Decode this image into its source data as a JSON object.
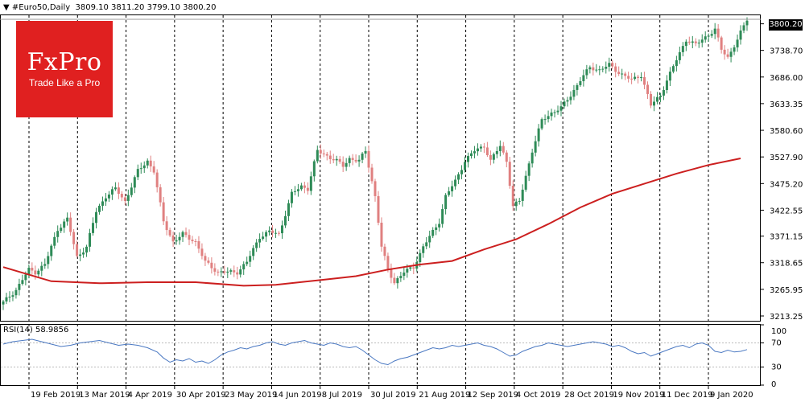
{
  "header": {
    "symbol": "#Euro50,Daily",
    "ohlc": "3809.10 3811.20 3799.10 3800.20",
    "current_price": "3800.20"
  },
  "logo": {
    "brand": "FxPro",
    "tagline": "Trade Like a Pro",
    "color": "#e02020"
  },
  "rsi_header": {
    "label": "RSI(14) 58.9856"
  },
  "colors": {
    "bull": "#2e8b57",
    "bear": "#e08080",
    "ma": "#cc1f1f",
    "rsi": "#4a78c2",
    "grid": "#000000"
  },
  "chart_data": [
    {
      "type": "candlestick",
      "title": "#Euro50,Daily",
      "ylim": [
        3213.25,
        3800.2
      ],
      "yticks": [
        3791.25,
        3738.7,
        3686.0,
        3633.35,
        3580.6,
        3527.9,
        3475.2,
        3422.55,
        3371.15,
        3318.65,
        3265.95,
        3213.25
      ],
      "ytick_labels": [
        "3791.25",
        "3738.70",
        "3686.00",
        "3633.35",
        "3580.60",
        "3527.90",
        "3475.20",
        "3422.55",
        "3371.15",
        "3318.65",
        "3265.95",
        "3213.25"
      ],
      "x_labels": [
        "19 Feb 2019",
        "13 Mar 2019",
        "4 Apr 2019",
        "30 Apr 2019",
        "23 May 2019",
        "14 Jun 2019",
        "8 Jul 2019",
        "30 Jul 2019",
        "21 Aug 2019",
        "12 Sep 2019",
        "4 Oct 2019",
        "28 Oct 2019",
        "19 Nov 2019",
        "11 Dec 2019",
        "9 Jan 2020"
      ],
      "close_path": [
        [
          0,
          3240
        ],
        [
          4,
          3265
        ],
        [
          8,
          3305
        ],
        [
          10,
          3300
        ],
        [
          13,
          3315
        ],
        [
          17,
          3385
        ],
        [
          20,
          3405
        ],
        [
          23,
          3330
        ],
        [
          26,
          3350
        ],
        [
          29,
          3420
        ],
        [
          32,
          3450
        ],
        [
          35,
          3465
        ],
        [
          38,
          3440
        ],
        [
          42,
          3500
        ],
        [
          45,
          3520
        ],
        [
          47,
          3500
        ],
        [
          50,
          3400
        ],
        [
          53,
          3360
        ],
        [
          56,
          3375
        ],
        [
          60,
          3360
        ],
        [
          63,
          3320
        ],
        [
          67,
          3300
        ],
        [
          70,
          3300
        ],
        [
          73,
          3300
        ],
        [
          76,
          3320
        ],
        [
          80,
          3370
        ],
        [
          83,
          3380
        ],
        [
          86,
          3375
        ],
        [
          90,
          3455
        ],
        [
          93,
          3470
        ],
        [
          95,
          3465
        ],
        [
          98,
          3540
        ],
        [
          101,
          3530
        ],
        [
          104,
          3520
        ],
        [
          106,
          3510
        ],
        [
          108,
          3525
        ],
        [
          111,
          3520
        ],
        [
          113,
          3540
        ],
        [
          116,
          3450
        ],
        [
          118,
          3350
        ],
        [
          120,
          3305
        ],
        [
          122,
          3280
        ],
        [
          125,
          3300
        ],
        [
          128,
          3310
        ],
        [
          131,
          3350
        ],
        [
          134,
          3380
        ],
        [
          136,
          3400
        ],
        [
          138,
          3450
        ],
        [
          141,
          3480
        ],
        [
          144,
          3520
        ],
        [
          147,
          3540
        ],
        [
          150,
          3550
        ],
        [
          152,
          3520
        ],
        [
          155,
          3550
        ],
        [
          157,
          3520
        ],
        [
          159,
          3430
        ],
        [
          161,
          3440
        ],
        [
          163,
          3490
        ],
        [
          165,
          3540
        ],
        [
          168,
          3600
        ],
        [
          171,
          3615
        ],
        [
          174,
          3625
        ],
        [
          177,
          3650
        ],
        [
          180,
          3680
        ],
        [
          183,
          3705
        ],
        [
          186,
          3700
        ],
        [
          189,
          3710
        ],
        [
          192,
          3695
        ],
        [
          196,
          3680
        ],
        [
          199,
          3690
        ],
        [
          202,
          3630
        ],
        [
          205,
          3650
        ],
        [
          207,
          3680
        ],
        [
          210,
          3720
        ],
        [
          213,
          3760
        ],
        [
          216,
          3750
        ],
        [
          219,
          3765
        ],
        [
          222,
          3780
        ],
        [
          224,
          3740
        ],
        [
          226,
          3725
        ],
        [
          229,
          3760
        ],
        [
          232,
          3800
        ]
      ],
      "ma200": {
        "name": "MA 200",
        "points": [
          [
            0,
            3310
          ],
          [
            15,
            3282
          ],
          [
            30,
            3278
          ],
          [
            45,
            3280
          ],
          [
            60,
            3280
          ],
          [
            75,
            3273
          ],
          [
            85,
            3275
          ],
          [
            100,
            3285
          ],
          [
            110,
            3292
          ],
          [
            120,
            3305
          ],
          [
            130,
            3315
          ],
          [
            140,
            3322
          ],
          [
            150,
            3345
          ],
          [
            160,
            3365
          ],
          [
            170,
            3395
          ],
          [
            180,
            3428
          ],
          [
            190,
            3455
          ],
          [
            200,
            3475
          ],
          [
            210,
            3495
          ],
          [
            220,
            3512
          ],
          [
            230,
            3525
          ]
        ]
      }
    },
    {
      "type": "line",
      "title": "RSI(14)",
      "ylim": [
        0,
        100
      ],
      "yticks": [
        100,
        70,
        30,
        0
      ],
      "levels": [
        70,
        30
      ],
      "series": [
        {
          "name": "RSI(14)",
          "points": [
            [
              0,
              68
            ],
            [
              3,
              72
            ],
            [
              6,
              74
            ],
            [
              9,
              76
            ],
            [
              12,
              72
            ],
            [
              15,
              68
            ],
            [
              18,
              64
            ],
            [
              21,
              66
            ],
            [
              24,
              70
            ],
            [
              27,
              72
            ],
            [
              30,
              74
            ],
            [
              33,
              70
            ],
            [
              36,
              66
            ],
            [
              39,
              68
            ],
            [
              42,
              66
            ],
            [
              45,
              62
            ],
            [
              48,
              55
            ],
            [
              50,
              45
            ],
            [
              52,
              38
            ],
            [
              54,
              42
            ],
            [
              56,
              40
            ],
            [
              58,
              44
            ],
            [
              60,
              38
            ],
            [
              62,
              40
            ],
            [
              64,
              36
            ],
            [
              66,
              42
            ],
            [
              68,
              50
            ],
            [
              70,
              55
            ],
            [
              72,
              58
            ],
            [
              74,
              62
            ],
            [
              76,
              60
            ],
            [
              78,
              64
            ],
            [
              80,
              66
            ],
            [
              82,
              70
            ],
            [
              84,
              72
            ],
            [
              86,
              68
            ],
            [
              88,
              66
            ],
            [
              90,
              70
            ],
            [
              92,
              72
            ],
            [
              94,
              74
            ],
            [
              96,
              70
            ],
            [
              98,
              68
            ],
            [
              100,
              66
            ],
            [
              102,
              70
            ],
            [
              104,
              68
            ],
            [
              106,
              64
            ],
            [
              108,
              62
            ],
            [
              110,
              64
            ],
            [
              112,
              58
            ],
            [
              114,
              50
            ],
            [
              116,
              42
            ],
            [
              118,
              36
            ],
            [
              120,
              34
            ],
            [
              122,
              40
            ],
            [
              124,
              44
            ],
            [
              126,
              46
            ],
            [
              128,
              50
            ],
            [
              130,
              54
            ],
            [
              132,
              58
            ],
            [
              134,
              62
            ],
            [
              136,
              60
            ],
            [
              138,
              62
            ],
            [
              140,
              66
            ],
            [
              142,
              64
            ],
            [
              144,
              66
            ],
            [
              146,
              68
            ],
            [
              148,
              70
            ],
            [
              150,
              66
            ],
            [
              152,
              64
            ],
            [
              154,
              60
            ],
            [
              156,
              54
            ],
            [
              158,
              48
            ],
            [
              160,
              50
            ],
            [
              162,
              56
            ],
            [
              164,
              60
            ],
            [
              166,
              64
            ],
            [
              168,
              66
            ],
            [
              170,
              70
            ],
            [
              172,
              68
            ],
            [
              174,
              66
            ],
            [
              176,
              64
            ],
            [
              178,
              66
            ],
            [
              180,
              68
            ],
            [
              182,
              70
            ],
            [
              184,
              72
            ],
            [
              186,
              70
            ],
            [
              188,
              68
            ],
            [
              190,
              64
            ],
            [
              192,
              66
            ],
            [
              194,
              62
            ],
            [
              196,
              56
            ],
            [
              198,
              52
            ],
            [
              200,
              54
            ],
            [
              202,
              48
            ],
            [
              204,
              52
            ],
            [
              206,
              56
            ],
            [
              208,
              60
            ],
            [
              210,
              64
            ],
            [
              212,
              66
            ],
            [
              214,
              62
            ],
            [
              216,
              68
            ],
            [
              218,
              70
            ],
            [
              220,
              66
            ],
            [
              222,
              56
            ],
            [
              224,
              54
            ],
            [
              226,
              58
            ],
            [
              228,
              55
            ],
            [
              230,
              56
            ],
            [
              232,
              59
            ]
          ]
        }
      ]
    }
  ]
}
